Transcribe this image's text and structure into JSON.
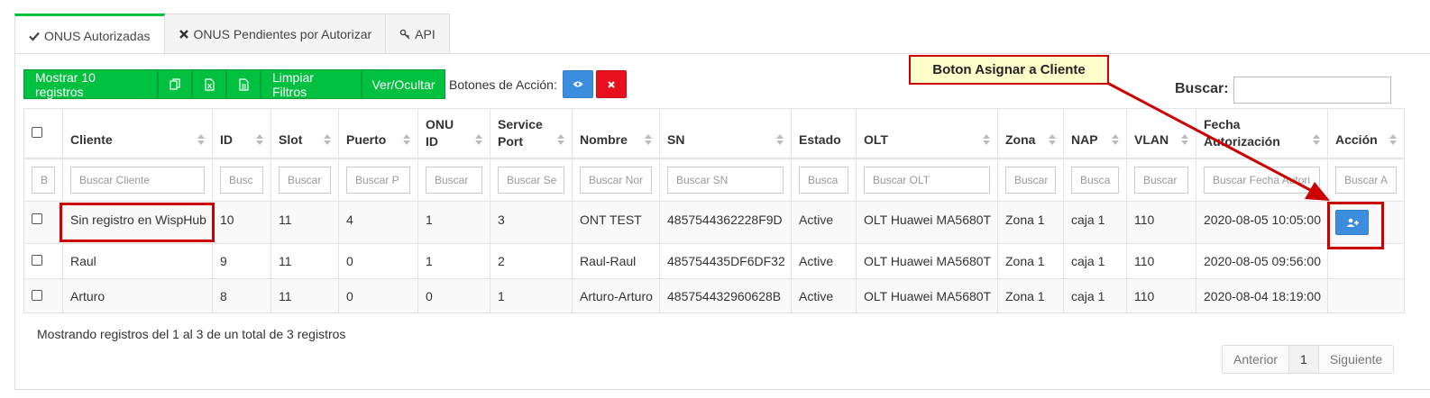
{
  "tabs": [
    {
      "label": "ONUS Autorizadas",
      "icon": "check-icon",
      "active": true
    },
    {
      "label": "ONUS Pendientes por Autorizar",
      "icon": "x-icon",
      "active": false
    },
    {
      "label": "API",
      "icon": "key-icon",
      "active": false
    }
  ],
  "toolbar": {
    "show_records": "Mostrar 10 registros",
    "copy_icon": "copy-icon",
    "excel_icon": "excel-icon",
    "pdf_icon": "file-icon",
    "clear_filters": "Limpiar Filtros",
    "toggle_columns": "Ver/Ocultar",
    "actions_label": "Botones de Acción:",
    "view_icon": "eye-icon",
    "delete_icon": "x-icon"
  },
  "search": {
    "label": "Buscar:",
    "value": ""
  },
  "table": {
    "headers": [
      "Cliente",
      "ID",
      "Slot",
      "Puerto",
      "ONU ID",
      "Service Port",
      "Nombre",
      "SN",
      "Estado",
      "OLT",
      "Zona",
      "NAP",
      "VLAN",
      "Fecha Autorización",
      "Acción"
    ],
    "header_lines": {
      "onu": [
        "ONU",
        "ID"
      ],
      "service": [
        "Service",
        "Port"
      ],
      "fecha": [
        "Fecha",
        "Autorización"
      ]
    },
    "filters": [
      "B",
      "Buscar Cliente",
      "Busc",
      "Buscar",
      "Buscar P",
      "Buscar",
      "Buscar Se",
      "Buscar Nor",
      "Buscar SN",
      "Busca",
      "Buscar OLT",
      "Buscar",
      "Busca",
      "Buscar",
      "Buscar Fecha Autori",
      "Buscar A"
    ],
    "rows": [
      {
        "cliente": "Sin registro en WispHub",
        "id": "10",
        "slot": "11",
        "puerto": "4",
        "onu_id": "1",
        "service_port": "3",
        "nombre": "ONT TEST",
        "sn": "4857544362228F9D",
        "estado": "Active",
        "olt": "OLT Huawei MA5680T",
        "zona": "Zona 1",
        "nap": "caja 1",
        "vlan": "110",
        "fecha": "2020-08-05 10:05:00"
      },
      {
        "cliente": "Raul",
        "id": "9",
        "slot": "11",
        "puerto": "0",
        "onu_id": "1",
        "service_port": "2",
        "nombre": "Raul-Raul",
        "sn": "485754435DF6DF32",
        "estado": "Active",
        "olt": "OLT Huawei MA5680T",
        "zona": "Zona 1",
        "nap": "caja 1",
        "vlan": "110",
        "fecha": "2020-08-05 09:56:00"
      },
      {
        "cliente": "Arturo",
        "id": "8",
        "slot": "11",
        "puerto": "0",
        "onu_id": "0",
        "service_port": "1",
        "nombre": "Arturo-Arturo",
        "sn": "485754432960628B",
        "estado": "Active",
        "olt": "OLT Huawei MA5680T",
        "zona": "Zona 1",
        "nap": "caja 1",
        "vlan": "110",
        "fecha": "2020-08-04 18:19:00"
      }
    ],
    "assign_icon": "user-plus-icon"
  },
  "footer": {
    "info": "Mostrando registros del 1 al 3 de un total de 3 registros",
    "prev": "Anterior",
    "page": "1",
    "next": "Siguiente"
  },
  "annotation": {
    "callout": "Boton Asignar a Cliente"
  },
  "colors": {
    "green": "#00c040",
    "blue": "#3c8dde",
    "red": "#e8101c",
    "annotation_red": "#cc0000",
    "callout_bg": "#ffffcc"
  }
}
